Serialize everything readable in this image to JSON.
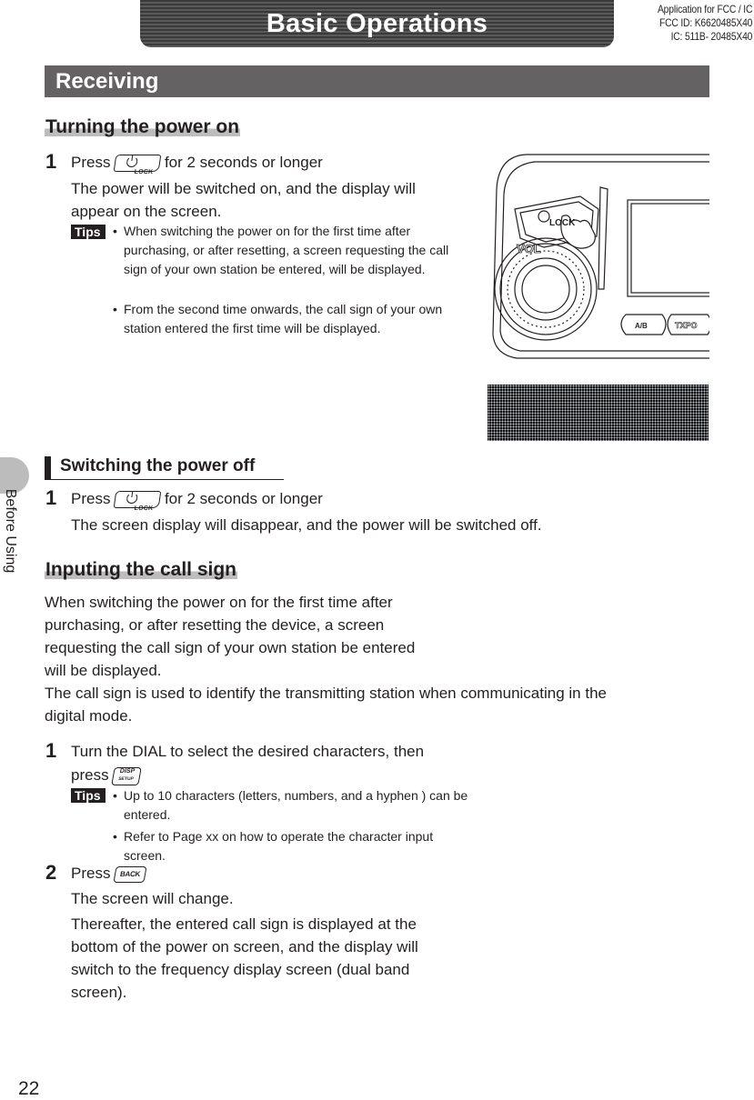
{
  "header": {
    "title": "Basic Operations",
    "fcc_lines": [
      "Application for FCC / IC",
      "FCC ID: K6620485X40",
      "IC: 511B- 20485X40"
    ]
  },
  "section": {
    "title": "Receiving"
  },
  "side_tab": {
    "label": "Before Using"
  },
  "page_number": "22",
  "keys": {
    "lock": "LOCK",
    "disp_top": "DISP",
    "disp_bottom": "SETUP",
    "back": "BACK"
  },
  "power_on": {
    "heading": "Turning the power on",
    "steps": [
      {
        "num": "1",
        "press_word": "Press",
        "after_key": "for 2 seconds or longer",
        "desc": "The power will be switched on, and the display will appear on the screen.",
        "tips_label": "Tips",
        "tips": [
          "When switching the power on for the first time after purchasing, or after resetting, a screen requesting the call sign of your own station be entered, will be displayed.",
          "From the second time onwards, the call sign of your own station entered the first time will be displayed."
        ]
      }
    ],
    "illustration": {
      "labels": [
        "LOCK",
        "VOL",
        "A/B",
        "TXPO"
      ]
    }
  },
  "power_off": {
    "heading": "Switching the power off",
    "steps": [
      {
        "num": "1",
        "press_word": "Press",
        "after_key": "for 2 seconds or longer",
        "desc": "The screen display will disappear, and the power will be switched off."
      }
    ]
  },
  "call_sign": {
    "heading": "Inputing the call sign",
    "intro_lines": [
      "When switching the power on for the first time after",
      "purchasing, or after resetting the device, a screen",
      "requesting the call sign of your own station be entered",
      "will be displayed.",
      "The call sign is used to identify the transmitting station when communicating in the",
      "digital mode."
    ],
    "steps": [
      {
        "num": "1",
        "text_line1": "Turn the DIAL to select the desired characters, then",
        "text_line2": "press",
        "tips_label": "Tips",
        "tips": [
          "Up to 10 characters (letters, numbers, and a hyphen ) can be entered.",
          "Refer to Page xx on how to operate the character input screen."
        ]
      },
      {
        "num": "2",
        "press_word": "Press",
        "desc1": "The screen will change.",
        "desc2": "Thereafter, the entered call sign is displayed at the bottom of the power on screen, and the display will switch to the frequency display screen (dual band screen)."
      }
    ]
  }
}
